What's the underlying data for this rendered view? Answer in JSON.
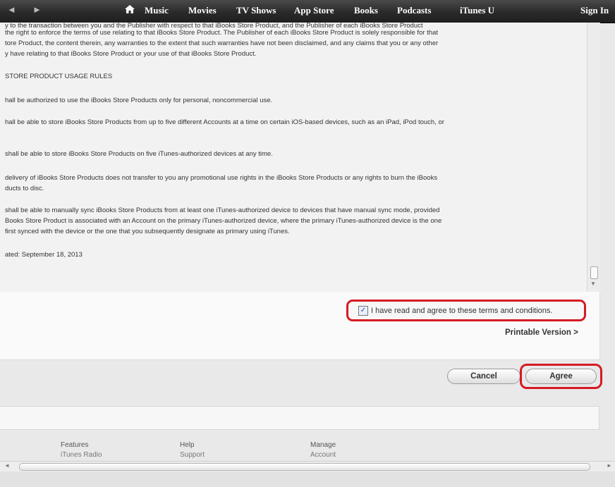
{
  "nav": {
    "back_icon": "◄",
    "forward_icon": "►",
    "home_icon": "house",
    "items": [
      "Music",
      "Movies",
      "TV Shows",
      "App Store",
      "Books",
      "Podcasts",
      "iTunes U"
    ],
    "sign_in": "Sign In"
  },
  "terms": {
    "lines": [
      "y to the transaction between you and the Publisher with respect to that iBooks Store Product, and the Publisher of each iBooks Store Product",
      " the right to enforce the terms of use relating to that iBooks Store Product. The Publisher of each iBooks Store Product is solely responsible for that",
      "tore Product, the content therein, any warranties to the extent that such warranties have not been disclaimed, and any claims that you or any other",
      "y have relating to that iBooks Store Product or your use of that iBooks Store Product.",
      "STORE PRODUCT USAGE RULES",
      "hall be authorized to use the iBooks Store Products only for personal, noncommercial use.",
      "hall be able to store iBooks Store Products from up to five different Accounts at a time on certain iOS-based devices, such as an iPad, iPod touch, or",
      "shall be able to store iBooks Store Products on five iTunes-authorized devices at any time.",
      "delivery of iBooks Store Products does not transfer to you any promotional use rights in the iBooks Store Products or any rights to burn the iBooks",
      "ducts to disc.",
      "shall be able to manually sync iBooks Store Products from at least one iTunes-authorized device to devices that have manual sync mode, provided",
      "Books Store Product is associated with an Account on the primary iTunes-authorized device, where the primary iTunes-authorized device is the one",
      " first synced with the device or the one that you subsequently designate as primary using iTunes.",
      "ated: September 18, 2013"
    ]
  },
  "agreement": {
    "checkbox_checked": true,
    "checkbox_label": "I have read and agree to these terms and conditions.",
    "printable_version": "Printable Version >"
  },
  "buttons": {
    "cancel": "Cancel",
    "agree": "Agree"
  },
  "highlight_color": "#d51b24",
  "footer": {
    "features": {
      "heading": "Features",
      "link": "iTunes Radio"
    },
    "help": {
      "heading": "Help",
      "link": "Support"
    },
    "manage": {
      "heading": "Manage",
      "link": "Account"
    }
  }
}
